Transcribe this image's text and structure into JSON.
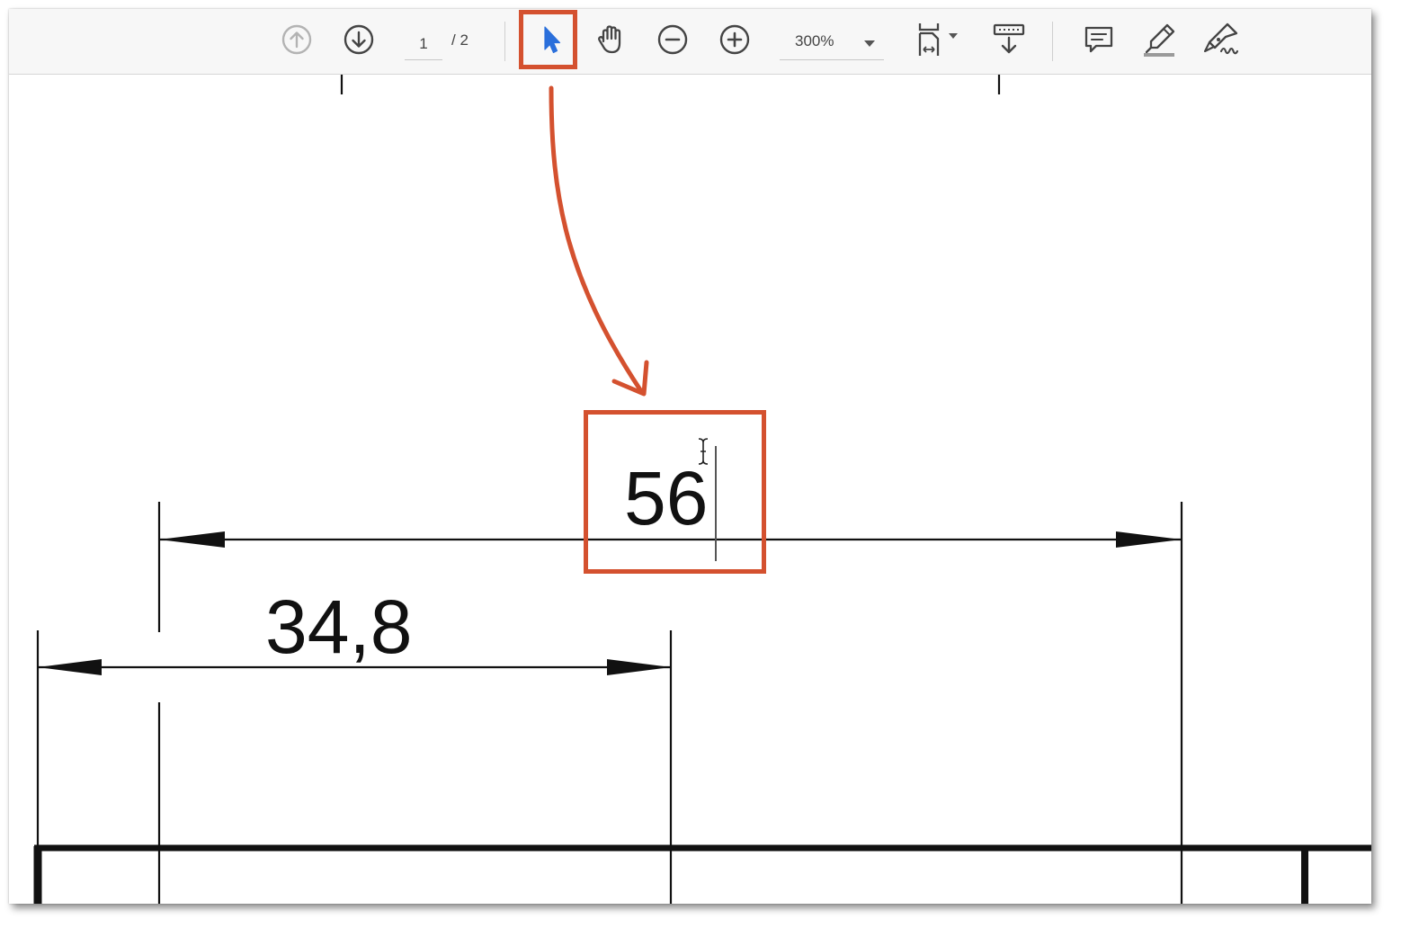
{
  "toolbar": {
    "current_page": "1",
    "page_total": "/ 2",
    "zoom": "300%"
  },
  "drawing": {
    "dimension_top": "56",
    "dimension_bottom": "34,8"
  },
  "colors": {
    "accent": "#d4512f",
    "tool_active": "#2a6fdb",
    "icon": "#444444"
  }
}
